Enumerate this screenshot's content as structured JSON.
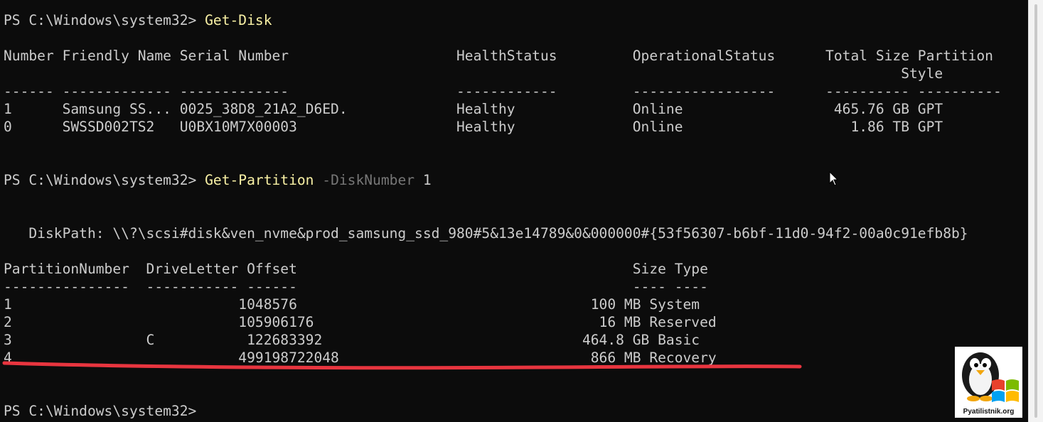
{
  "terminal": {
    "lines": [
      {
        "kind": "prompt",
        "prompt": "PS C:\\Windows\\system32> ",
        "cmd": "Get-Disk",
        "param": "",
        "arg": ""
      },
      {
        "kind": "text",
        "text": ""
      },
      {
        "kind": "text",
        "text": "Number Friendly Name Serial Number                    HealthStatus         OperationalStatus      Total Size Partition"
      },
      {
        "kind": "text",
        "text": "                                                                                                           Style"
      },
      {
        "kind": "text",
        "text": "------ ------------- -------------                    ------------         -----------------      ---------- ----------"
      },
      {
        "kind": "text",
        "text": "1      Samsung SS... 0025_38D8_21A2_D6ED.             Healthy              Online                  465.76 GB GPT"
      },
      {
        "kind": "text",
        "text": "0      SWSSD002TS2   U0BX10M7X00003                   Healthy              Online                    1.86 TB GPT"
      },
      {
        "kind": "text",
        "text": ""
      },
      {
        "kind": "text",
        "text": ""
      },
      {
        "kind": "prompt",
        "prompt": "PS C:\\Windows\\system32> ",
        "cmd": "Get-Partition",
        "param": "-DiskNumber",
        "arg": "1"
      },
      {
        "kind": "text",
        "text": ""
      },
      {
        "kind": "text",
        "text": ""
      },
      {
        "kind": "text",
        "text": "   DiskPath: \\\\?\\scsi#disk&ven_nvme&prod_samsung_ssd_980#5&13e14789&0&000000#{53f56307-b6bf-11d0-94f2-00a0c91efb8b}"
      },
      {
        "kind": "text",
        "text": ""
      },
      {
        "kind": "text",
        "text": "PartitionNumber  DriveLetter Offset                                        Size Type"
      },
      {
        "kind": "text",
        "text": "---------------  ----------- ------                                        ---- ----"
      },
      {
        "kind": "text",
        "text": "1                           1048576                                   100 MB System"
      },
      {
        "kind": "text",
        "text": "2                           105906176                                  16 MB Reserved"
      },
      {
        "kind": "text",
        "text": "3                C           122683392                               464.8 GB Basic"
      },
      {
        "kind": "text",
        "text": "4                           499198722048                              866 MB Recovery"
      },
      {
        "kind": "text",
        "text": ""
      },
      {
        "kind": "text",
        "text": ""
      },
      {
        "kind": "prompt",
        "prompt": "PS C:\\Windows\\system32>",
        "cmd": "",
        "param": "",
        "arg": ""
      }
    ]
  },
  "watermark": {
    "caption": "Pyatilistnik.org"
  },
  "colors": {
    "background": "#0c0c0c",
    "text": "#cccccc",
    "command": "#f9f1a5",
    "parameter": "#767676",
    "highlight": "#e8353f"
  }
}
